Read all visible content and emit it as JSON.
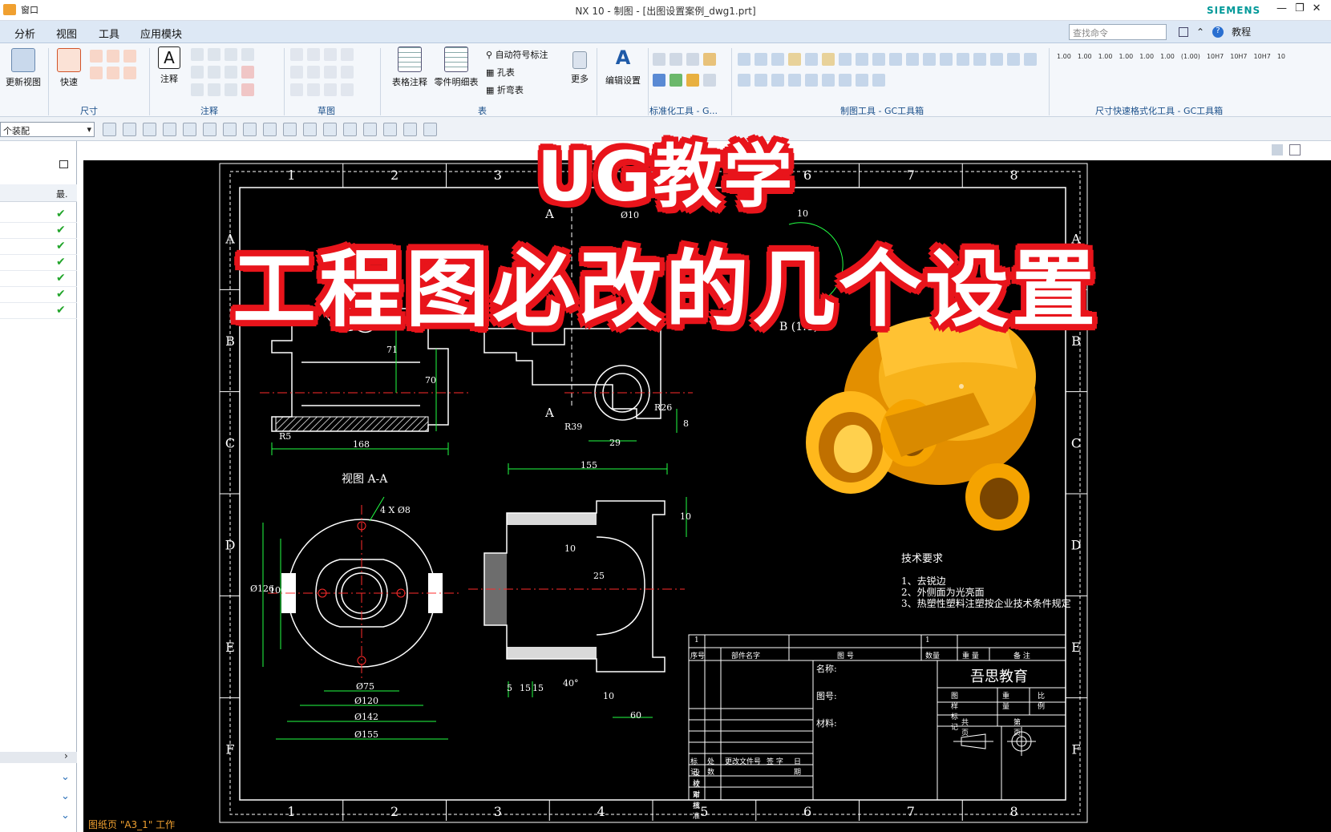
{
  "window": {
    "title": "NX 10 - 制图 - [出图设置案例_dwg1.prt]",
    "quick_access": "窗口",
    "brand": "SIEMENS",
    "controls": [
      "—",
      "❐",
      "✕"
    ]
  },
  "menu": {
    "tabs": [
      "分析",
      "视图",
      "工具",
      "应用模块"
    ],
    "search_placeholder": "查找命令",
    "help_label": "教程"
  },
  "ribbon": {
    "buttons": {
      "update_view": "更新视图",
      "quick": "快速",
      "annotation": "注释",
      "table_note": "表格注释",
      "parts_list": "零件明细表",
      "more": "更多",
      "edit_settings": "编辑设置"
    },
    "table_items": [
      "自动符号标注",
      "孔表",
      "折弯表"
    ],
    "groups": {
      "dimension": "尺寸",
      "annotation": "注释",
      "sketch": "草图",
      "table": "表",
      "std_tools": "标准化工具 - G...",
      "drafting_tools": "制图工具 - GC工具箱",
      "dim_format_tools": "尺寸快速格式化工具 - GC工具箱"
    },
    "dim_format_values": [
      "1.00",
      "1.00",
      "1.00",
      "1.00",
      "1.00",
      "1.00",
      "(1.00)",
      "10H7",
      "10H7",
      "10H7",
      "10"
    ]
  },
  "toolbar": {
    "selection_filter": "个装配"
  },
  "navigator": {
    "column_last": "最.",
    "rows": 7
  },
  "drawing": {
    "col_numbers": [
      "1",
      "2",
      "3",
      "4",
      "5",
      "6",
      "7",
      "8"
    ],
    "row_letters": [
      "A",
      "B",
      "C",
      "D",
      "E",
      "F"
    ],
    "section_label": "视图 A-A",
    "detail_label": "B (1:1)",
    "section_mark": "A",
    "tech_title": "技术要求",
    "tech_lines": [
      "1、去锐边",
      "2、外侧面为光亮面",
      "3、热塑性塑料注塑按企业技术条件规定"
    ],
    "dims_top": [
      "Ø10",
      "10",
      "71",
      "70",
      "168",
      "R5",
      "R39",
      "R26",
      "29",
      "155",
      "8"
    ],
    "dims_bottom": [
      "4 X Ø8",
      "Ø126",
      "100",
      "Ø75",
      "Ø120",
      "Ø142",
      "Ø155",
      "10",
      "25",
      "5",
      "15",
      "15",
      "40°",
      "10",
      "60",
      "10"
    ],
    "title_block": {
      "company": "吾思教育",
      "name_label": "名称:",
      "drawing_no_label": "图号:",
      "material_label": "材料:",
      "header_cells": [
        "序号",
        "部件名字",
        "图 号",
        "数量",
        "重 量",
        "备 注"
      ],
      "rev_cells": [
        "标记",
        "处数",
        "更改文件号",
        "签 字",
        "日期"
      ],
      "sign_rows": [
        "设 计",
        "校 对",
        "审 核",
        "批 准"
      ],
      "stage_cells": [
        "图样标记",
        "重量",
        "比例"
      ],
      "sheet_cells": [
        "共 页",
        "第 页"
      ],
      "one_a": "1",
      "one_b": "1"
    }
  },
  "status": {
    "sheet": "图纸页 \"A3_1\" 工作"
  },
  "overlay": {
    "line1": "UG教学",
    "line2": "工程图必改的几个设置"
  },
  "colors": {
    "accent_red": "#e8141b",
    "drawing_bg": "#000000",
    "dim_green": "#00ff33",
    "part_gold": "#f5a300"
  }
}
